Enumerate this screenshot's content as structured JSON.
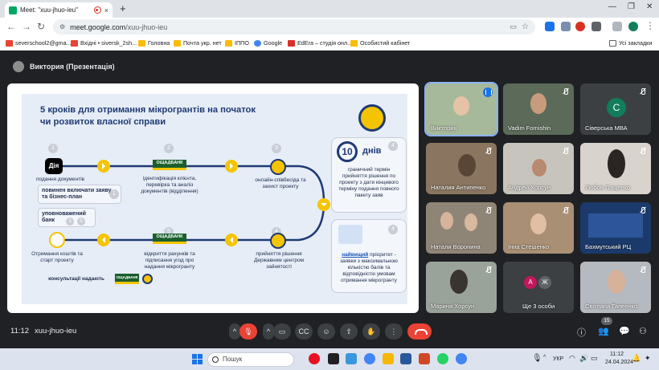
{
  "browser": {
    "tab_title": "Meet: \"xuu-jhuo-ieu\"",
    "tab_close": "×",
    "new_tab": "+",
    "url_host": "meet.google.com",
    "url_path": "/xuu-jhuo-ieu",
    "all_bookmarks": "Усі закладки",
    "bookmarks": [
      {
        "label": "severschool2@gma...",
        "color": "#ea4335"
      },
      {
        "label": "Вхідні • siversk_2sh...",
        "color": "#ea4335"
      },
      {
        "label": "Головна",
        "color": "#fbbc04"
      },
      {
        "label": "Почта укр. нет",
        "color": "#fbbc04"
      },
      {
        "label": "ІППО",
        "color": "#fbbc04"
      },
      {
        "label": "Google",
        "color": "#4285f4"
      },
      {
        "label": "EdEra – студія онл...",
        "color": "#d93025"
      },
      {
        "label": "Особистий кабінет",
        "color": "#fbbc04"
      }
    ]
  },
  "meet": {
    "presenter_label": "Виктория (Презентація)",
    "time": "11:12",
    "code": "xuu-jhuo-ieu",
    "participants_count": "15"
  },
  "slide": {
    "title": "5 кроків для отримання мікрогрантів на початок чи розвиток власної справи",
    "dia_label": "Дія",
    "bank_label": "ОЩАДБАНК",
    "step1_text": "подання документів",
    "step1_note": "повинен включати заяву та бізнес-план",
    "step2_text": "ідентифікація клієнта, перевірка та аналіз документів (відділення)",
    "step3_text": "онлайн-співбесіда та захист проекту",
    "bank_note": "уповноважений банк",
    "step4_text": "прийняття рішення Державним центром зайнятості",
    "step5_text": "відкриття рахунків та підписання угод про надання мікрогранту",
    "final_text": "Отримання коштів та старт проекту",
    "consult_text": "консультації надають",
    "days_number": "10",
    "days_word": "днів",
    "days_text": "граничний термін прийняття рішення по проекту з дати кінцевого терміну подання повного пакету заяв",
    "priority_highlight": "найвищий",
    "priority_text": "пріоритет - заявки з максимальною кількістю балів та відповідністю умовам отримання мікрогранту",
    "n1": "1",
    "n2": "2",
    "n3": "3",
    "n4": "4",
    "n5": "5"
  },
  "tiles": [
    {
      "name": "Виктория",
      "bg": "#a7b99b",
      "speaking": true
    },
    {
      "name": "Vadim Fomishin",
      "bg": "#5c6a5a"
    },
    {
      "name": "Сіверська МВА",
      "avatar": "C",
      "bg": "#3c4043"
    },
    {
      "name": "Наталия Антипенко",
      "bg": "#8a7560"
    },
    {
      "name": "Андрей Хорсун",
      "bg": "#c7c4bd"
    },
    {
      "name": "Любов Лащенко",
      "bg": "#d8d3cc"
    },
    {
      "name": "Натали Воронина",
      "bg": "#8f8577"
    },
    {
      "name": "Інна Стешенко",
      "bg": "#a98f74"
    },
    {
      "name": "Бахмутський РЦ",
      "bg": "#1b3a6b"
    },
    {
      "name": "Марина Хорсун",
      "bg": "#9aa39a"
    },
    {
      "name": "Ще 3 особи",
      "others": [
        "А",
        "Ж"
      ],
      "bg": "#3c4043"
    },
    {
      "name": "Світлана Гапеенко",
      "bg": "#b5b9c0"
    }
  ],
  "taskbar": {
    "search_placeholder": "Пошук",
    "lang": "УКР",
    "clock_time": "11:12",
    "clock_date": "24.04.2024"
  }
}
